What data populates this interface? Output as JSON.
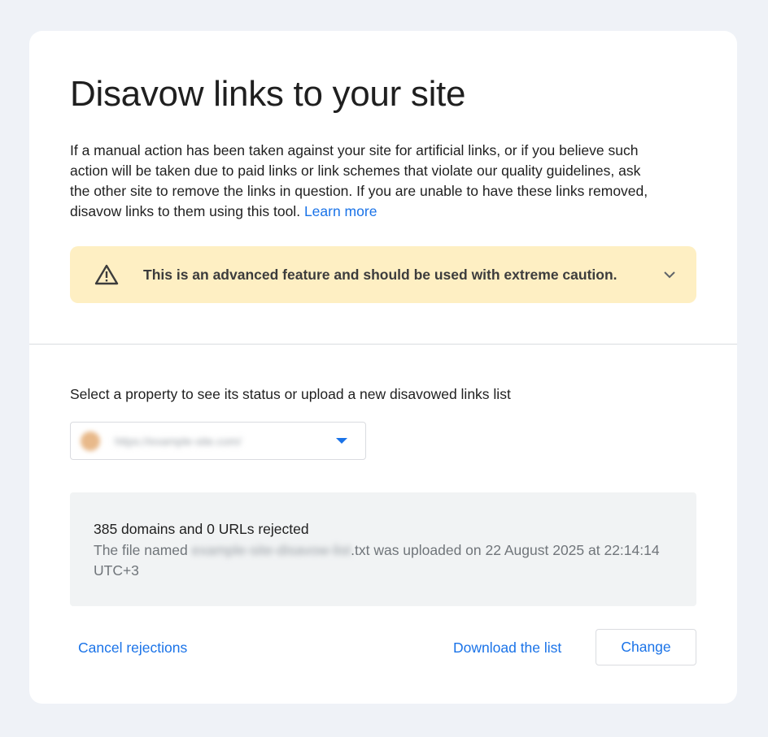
{
  "page": {
    "title": "Disavow links to your site",
    "description": "If a manual action has been taken against your site for artificial links, or if you believe such action will be taken due to paid links or link schemes that violate our quality guidelines, ask the other site to remove the links in question. If you are unable to have these links removed, disavow links to them using this tool.",
    "learn_more": "Learn more"
  },
  "warning": {
    "icon": "warning-triangle-icon",
    "text": "This is an advanced feature and should be used with extreme caution.",
    "expand_icon": "chevron-down-icon"
  },
  "property": {
    "label": "Select a property to see its status or upload a new disavowed links list",
    "selected_value": "https://example-site.com/",
    "dropdown_icon": "caret-down-icon"
  },
  "status": {
    "summary": "385 domains and 0 URLs rejected",
    "detail_prefix": "The file named",
    "file_name_blurred": "example-site-disavow-list",
    "detail_suffix": ".txt was uploaded on 22 August 2025 at 22:14:14 UTC+3"
  },
  "actions": {
    "cancel": "Cancel rejections",
    "download": "Download the list",
    "change": "Change"
  },
  "colors": {
    "accent": "#1a73e8",
    "warning_bg": "#feefc3",
    "page_bg": "#eff2f7"
  }
}
